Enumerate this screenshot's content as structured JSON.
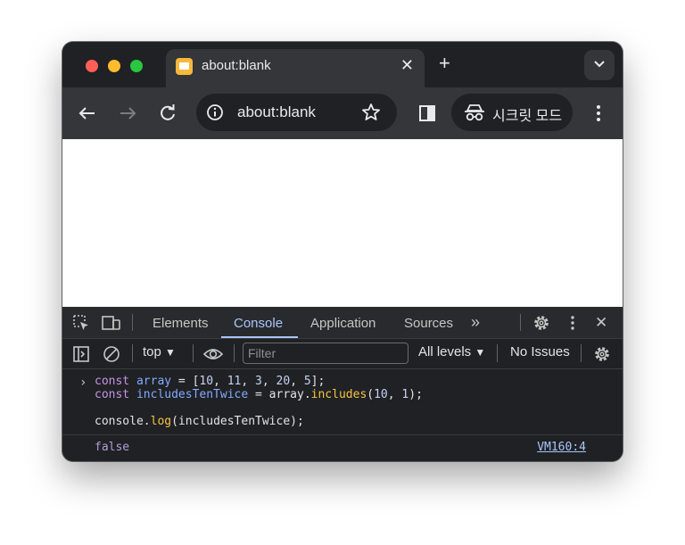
{
  "tab": {
    "title": "about:blank",
    "close_glyph": "✕",
    "new_tab_glyph": "+"
  },
  "toolbar": {
    "url": "about:blank",
    "incognito_label": "시크릿 모드",
    "icons": [
      "back-arrow-icon",
      "forward-arrow-icon",
      "reload-icon",
      "info-icon",
      "star-icon",
      "side-panel-icon",
      "incognito-icon",
      "kebab-menu-icon"
    ]
  },
  "devtools": {
    "tabs": [
      "Elements",
      "Console",
      "Application",
      "Sources"
    ],
    "active_tab": "Console",
    "more_tabs_glyph": "»",
    "context": "top",
    "filter_placeholder": "Filter",
    "levels": "All levels",
    "issues": "No Issues",
    "close_glyph": "✕"
  },
  "console": {
    "prompt": "›",
    "lines": [
      "const array = [10, 11, 3, 20, 5];",
      "const includesTenTwice = array.includes(10, 1);",
      "",
      "console.log(includesTenTwice);"
    ],
    "result": "false",
    "source_link": "VM160:4"
  },
  "colors": {
    "accent": "#a8c7fa",
    "keyword": "#c792ea",
    "result": "#b39ddb"
  }
}
